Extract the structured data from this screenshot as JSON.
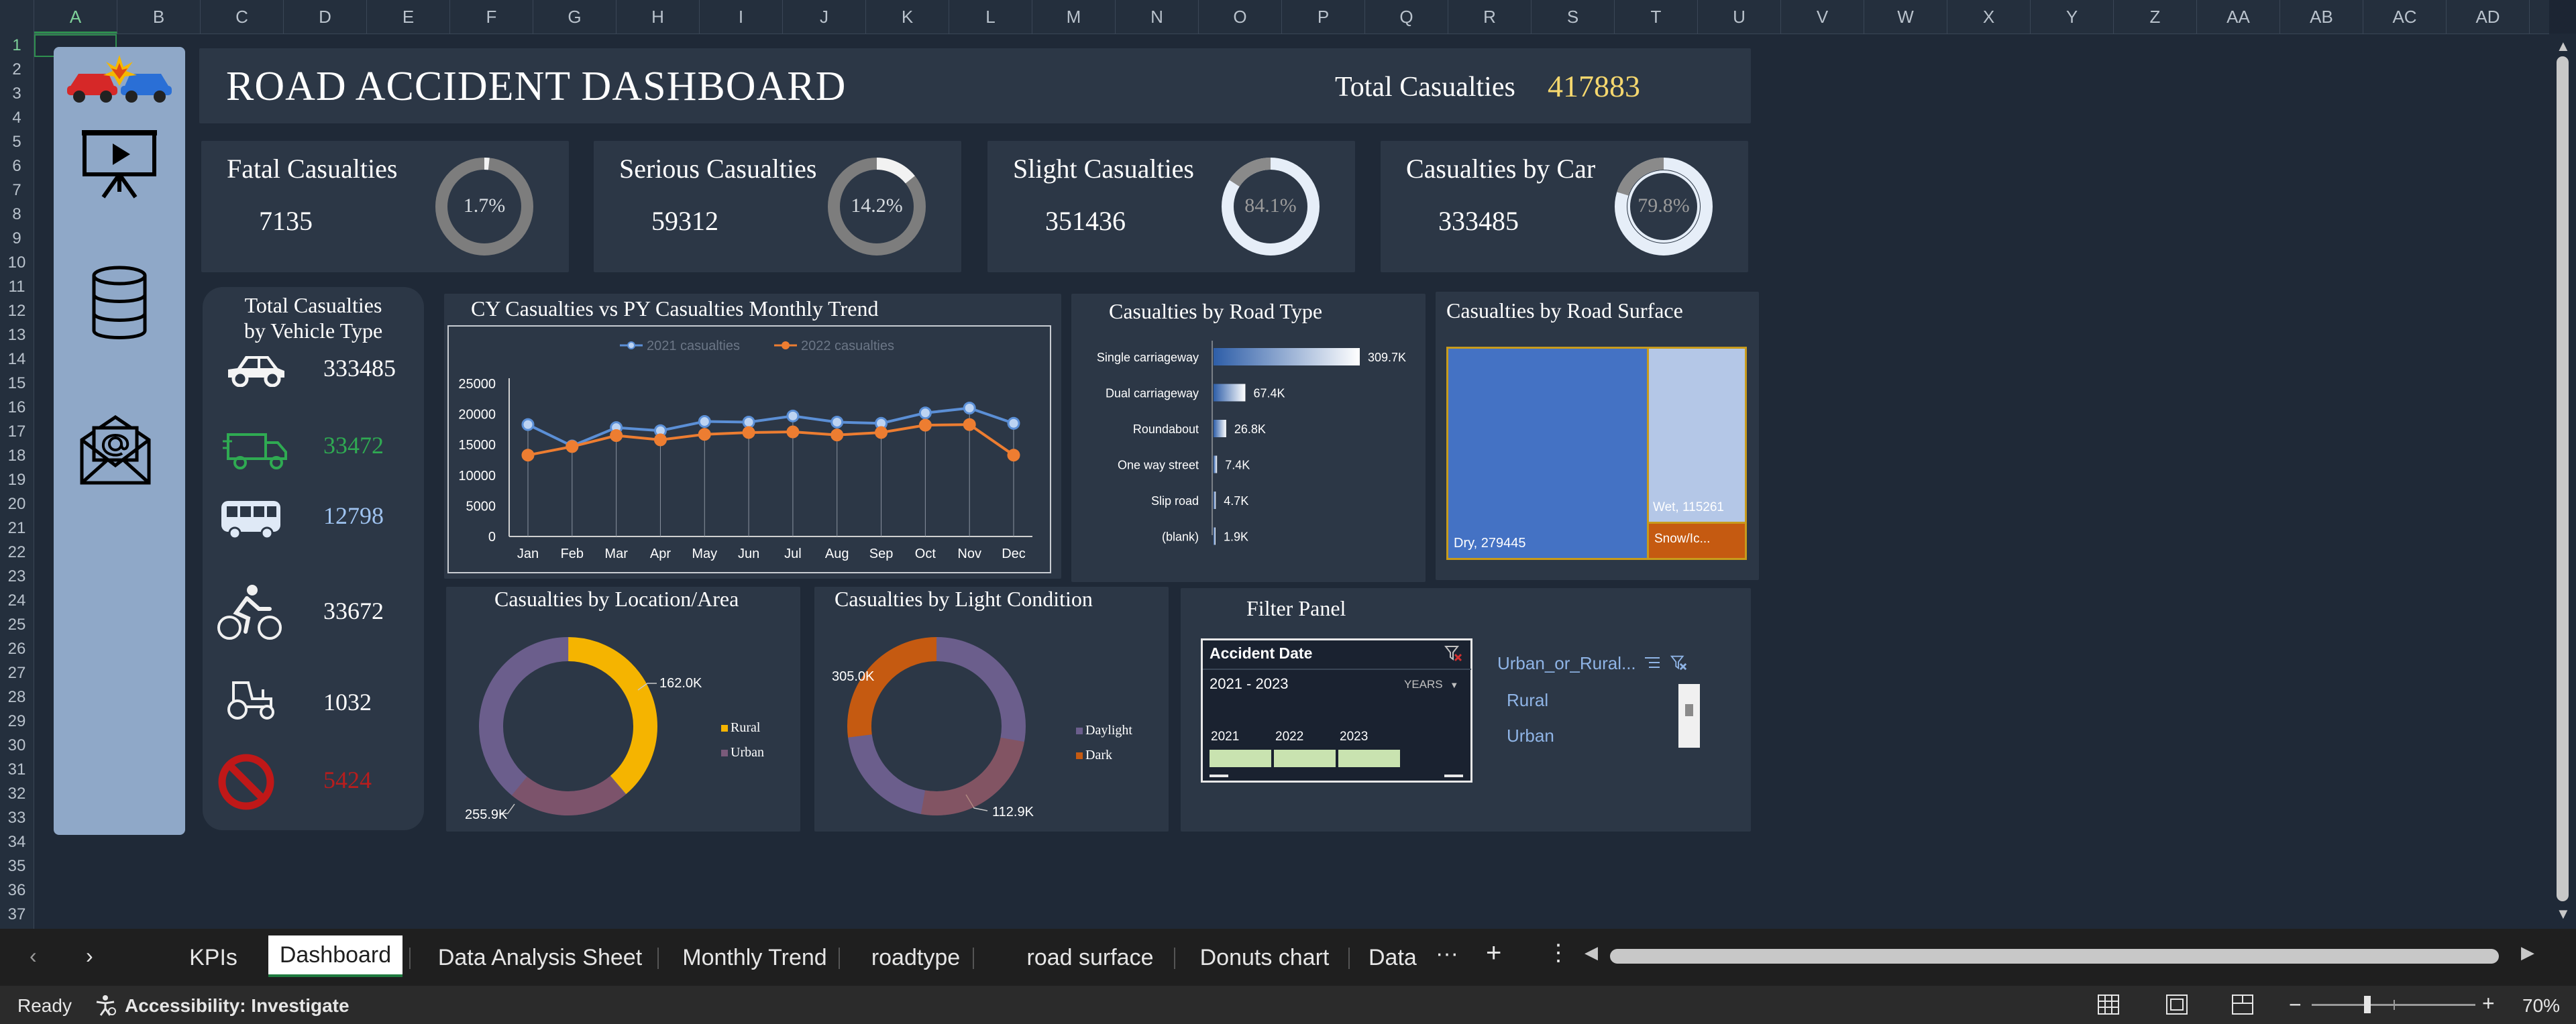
{
  "column_headers": [
    "A",
    "B",
    "C",
    "D",
    "E",
    "F",
    "G",
    "H",
    "I",
    "J",
    "K",
    "L",
    "M",
    "N",
    "O",
    "P",
    "Q",
    "R",
    "S",
    "T",
    "U",
    "V",
    "W",
    "X",
    "Y",
    "Z",
    "AA",
    "AB",
    "AC",
    "AD"
  ],
  "row_headers": [
    "1",
    "2",
    "3",
    "4",
    "5",
    "6",
    "7",
    "8",
    "9",
    "10",
    "11",
    "12",
    "13",
    "14",
    "15",
    "16",
    "17",
    "18",
    "19",
    "20",
    "21",
    "22",
    "23",
    "24",
    "25",
    "26",
    "27",
    "28",
    "29",
    "30",
    "31",
    "32",
    "33",
    "34",
    "35",
    "36",
    "37"
  ],
  "header": {
    "title": "ROAD ACCIDENT DASHBOARD",
    "total_label": "Total Casualties",
    "total_value": "417883"
  },
  "kpis": [
    {
      "title": "Fatal Casualties",
      "value": "7135",
      "pct": "1.7%",
      "fraction": 0.017
    },
    {
      "title": "Serious Casualties",
      "value": "59312",
      "pct": "14.2%",
      "fraction": 0.142
    },
    {
      "title": "Slight Casualties",
      "value": "351436",
      "pct": "84.1%",
      "fraction": 0.841
    },
    {
      "title": "Casualties by Car",
      "value": "333485",
      "pct": "79.8%",
      "fraction": 0.798
    }
  ],
  "vehicle_panel": {
    "title_line1": "Total Casualties",
    "title_line2": "by Vehicle Type",
    "items": [
      {
        "icon": "car-icon",
        "value": "333485",
        "color": "#ffffff"
      },
      {
        "icon": "truck-icon",
        "value": "33472",
        "color": "#2faa52"
      },
      {
        "icon": "bus-icon",
        "value": "12798",
        "color": "#9fc3f0"
      },
      {
        "icon": "bicycle-icon",
        "value": "33672",
        "color": "#ffffff"
      },
      {
        "icon": "tractor-icon",
        "value": "1032",
        "color": "#ffffff"
      },
      {
        "icon": "no-entry-icon",
        "value": "5424",
        "color": "#b81d1d"
      }
    ]
  },
  "trend": {
    "title": "CY Casualties vs PY Casualties Monthly Trend",
    "legend": [
      "2021 casualties",
      "2022 casualties"
    ],
    "y_ticks": [
      "25000",
      "20000",
      "15000",
      "10000",
      "5000",
      "0"
    ],
    "months": [
      "Jan",
      "Feb",
      "Mar",
      "Apr",
      "May",
      "Jun",
      "Jul",
      "Aug",
      "Sep",
      "Oct",
      "Nov",
      "Dec"
    ]
  },
  "road_type": {
    "title": "Casualties by Road Type",
    "categories": [
      "Single carriageway",
      "Dual carriageway",
      "Roundabout",
      "One way street",
      "Slip road",
      "(blank)"
    ],
    "labels": [
      "309.7K",
      "67.4K",
      "26.8K",
      "7.4K",
      "4.7K",
      "1.9K"
    ],
    "values": [
      309.7,
      67.4,
      26.8,
      7.4,
      4.7,
      1.9
    ]
  },
  "road_surface": {
    "title": "Casualties by Road Surface",
    "dry_label": "Dry, 279445",
    "wet_label": "Wet, 115261",
    "snow_label": "Snow/Ic..."
  },
  "location": {
    "title": "Casualties by Location/Area",
    "labels": [
      "162.0K",
      "255.9K"
    ],
    "legend": [
      "Rural",
      "Urban"
    ]
  },
  "light": {
    "title": "Casualties by Light Condition",
    "labels": [
      "112.9K",
      "305.0K"
    ],
    "legend": [
      "Daylight",
      "Dark"
    ]
  },
  "filter": {
    "title": "Filter Panel",
    "date_header": "Accident Date",
    "range": "2021 - 2023",
    "unit": "YEARS",
    "years": [
      "2021",
      "2022",
      "2023"
    ],
    "slicer_title": "Urban_or_Rural...",
    "options": [
      "Rural",
      "Urban"
    ]
  },
  "chart_data": [
    {
      "type": "line",
      "title": "CY Casualties vs PY Casualties Monthly Trend",
      "categories": [
        "Jan",
        "Feb",
        "Mar",
        "Apr",
        "May",
        "Jun",
        "Jul",
        "Aug",
        "Sep",
        "Oct",
        "Nov",
        "Dec"
      ],
      "ylim": [
        0,
        25000
      ],
      "series": [
        {
          "name": "2021 casualties",
          "color": "#5b8fd6",
          "values": [
            18300,
            14800,
            17800,
            17300,
            18800,
            18700,
            19700,
            18700,
            18500,
            20200,
            21000,
            18500
          ]
        },
        {
          "name": "2022 casualties",
          "color": "#ed7d31",
          "values": [
            13300,
            14700,
            16500,
            15800,
            16700,
            17000,
            17100,
            16600,
            17000,
            18200,
            18300,
            13300
          ]
        }
      ]
    },
    {
      "type": "bar",
      "title": "Casualties by Road Type",
      "categories": [
        "Single carriageway",
        "Dual carriageway",
        "Roundabout",
        "One way street",
        "Slip road",
        "(blank)"
      ],
      "values": [
        309700,
        67400,
        26800,
        7400,
        4700,
        1900
      ]
    },
    {
      "type": "heatmap",
      "title": "Casualties by Road Surface",
      "categories": [
        "Dry",
        "Wet",
        "Snow/Ic..."
      ],
      "values": [
        279445,
        115261,
        23177
      ]
    },
    {
      "type": "pie",
      "title": "Casualties by Location/Area",
      "categories": [
        "Rural",
        "Urban"
      ],
      "values": [
        162000,
        255900
      ]
    },
    {
      "type": "pie",
      "title": "Casualties by Light Condition",
      "categories": [
        "Daylight",
        "Dark"
      ],
      "values": [
        305000,
        112900
      ]
    }
  ],
  "tabs": [
    "KPIs",
    "Dashboard",
    "Data Analysis Sheet",
    "Monthly Trend",
    "roadtype",
    "road surface",
    "Donuts chart",
    "Data"
  ],
  "status": {
    "ready": "Ready",
    "accessibility": "Accessibility: Investigate",
    "zoom": "70%"
  },
  "colors": {
    "background": "#1f2937",
    "panel": "#2c3746",
    "accent_blue": "#4472c4",
    "accent_orange": "#ed7d31",
    "gold": "#f5d76e"
  }
}
